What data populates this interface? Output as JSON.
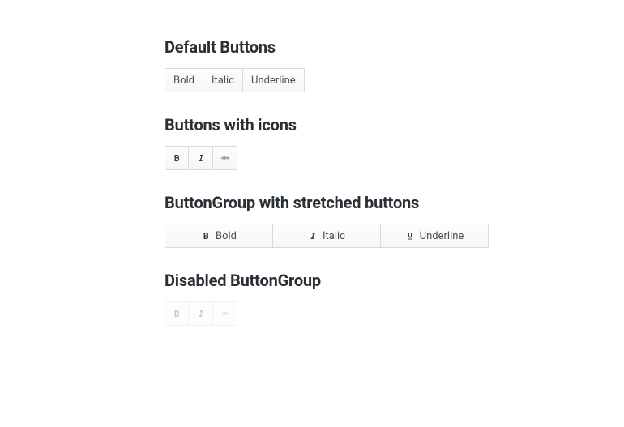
{
  "sections": {
    "default": {
      "title": "Default Buttons",
      "buttons": {
        "bold": "Bold",
        "italic": "Italic",
        "underline": "Underline"
      }
    },
    "icons": {
      "title": "Buttons with icons"
    },
    "stretched": {
      "title": "ButtonGroup with stretched buttons",
      "buttons": {
        "bold": "Bold",
        "italic": "Italic",
        "underline": "Underline"
      }
    },
    "disabled": {
      "title": "Disabled ButtonGroup"
    }
  }
}
